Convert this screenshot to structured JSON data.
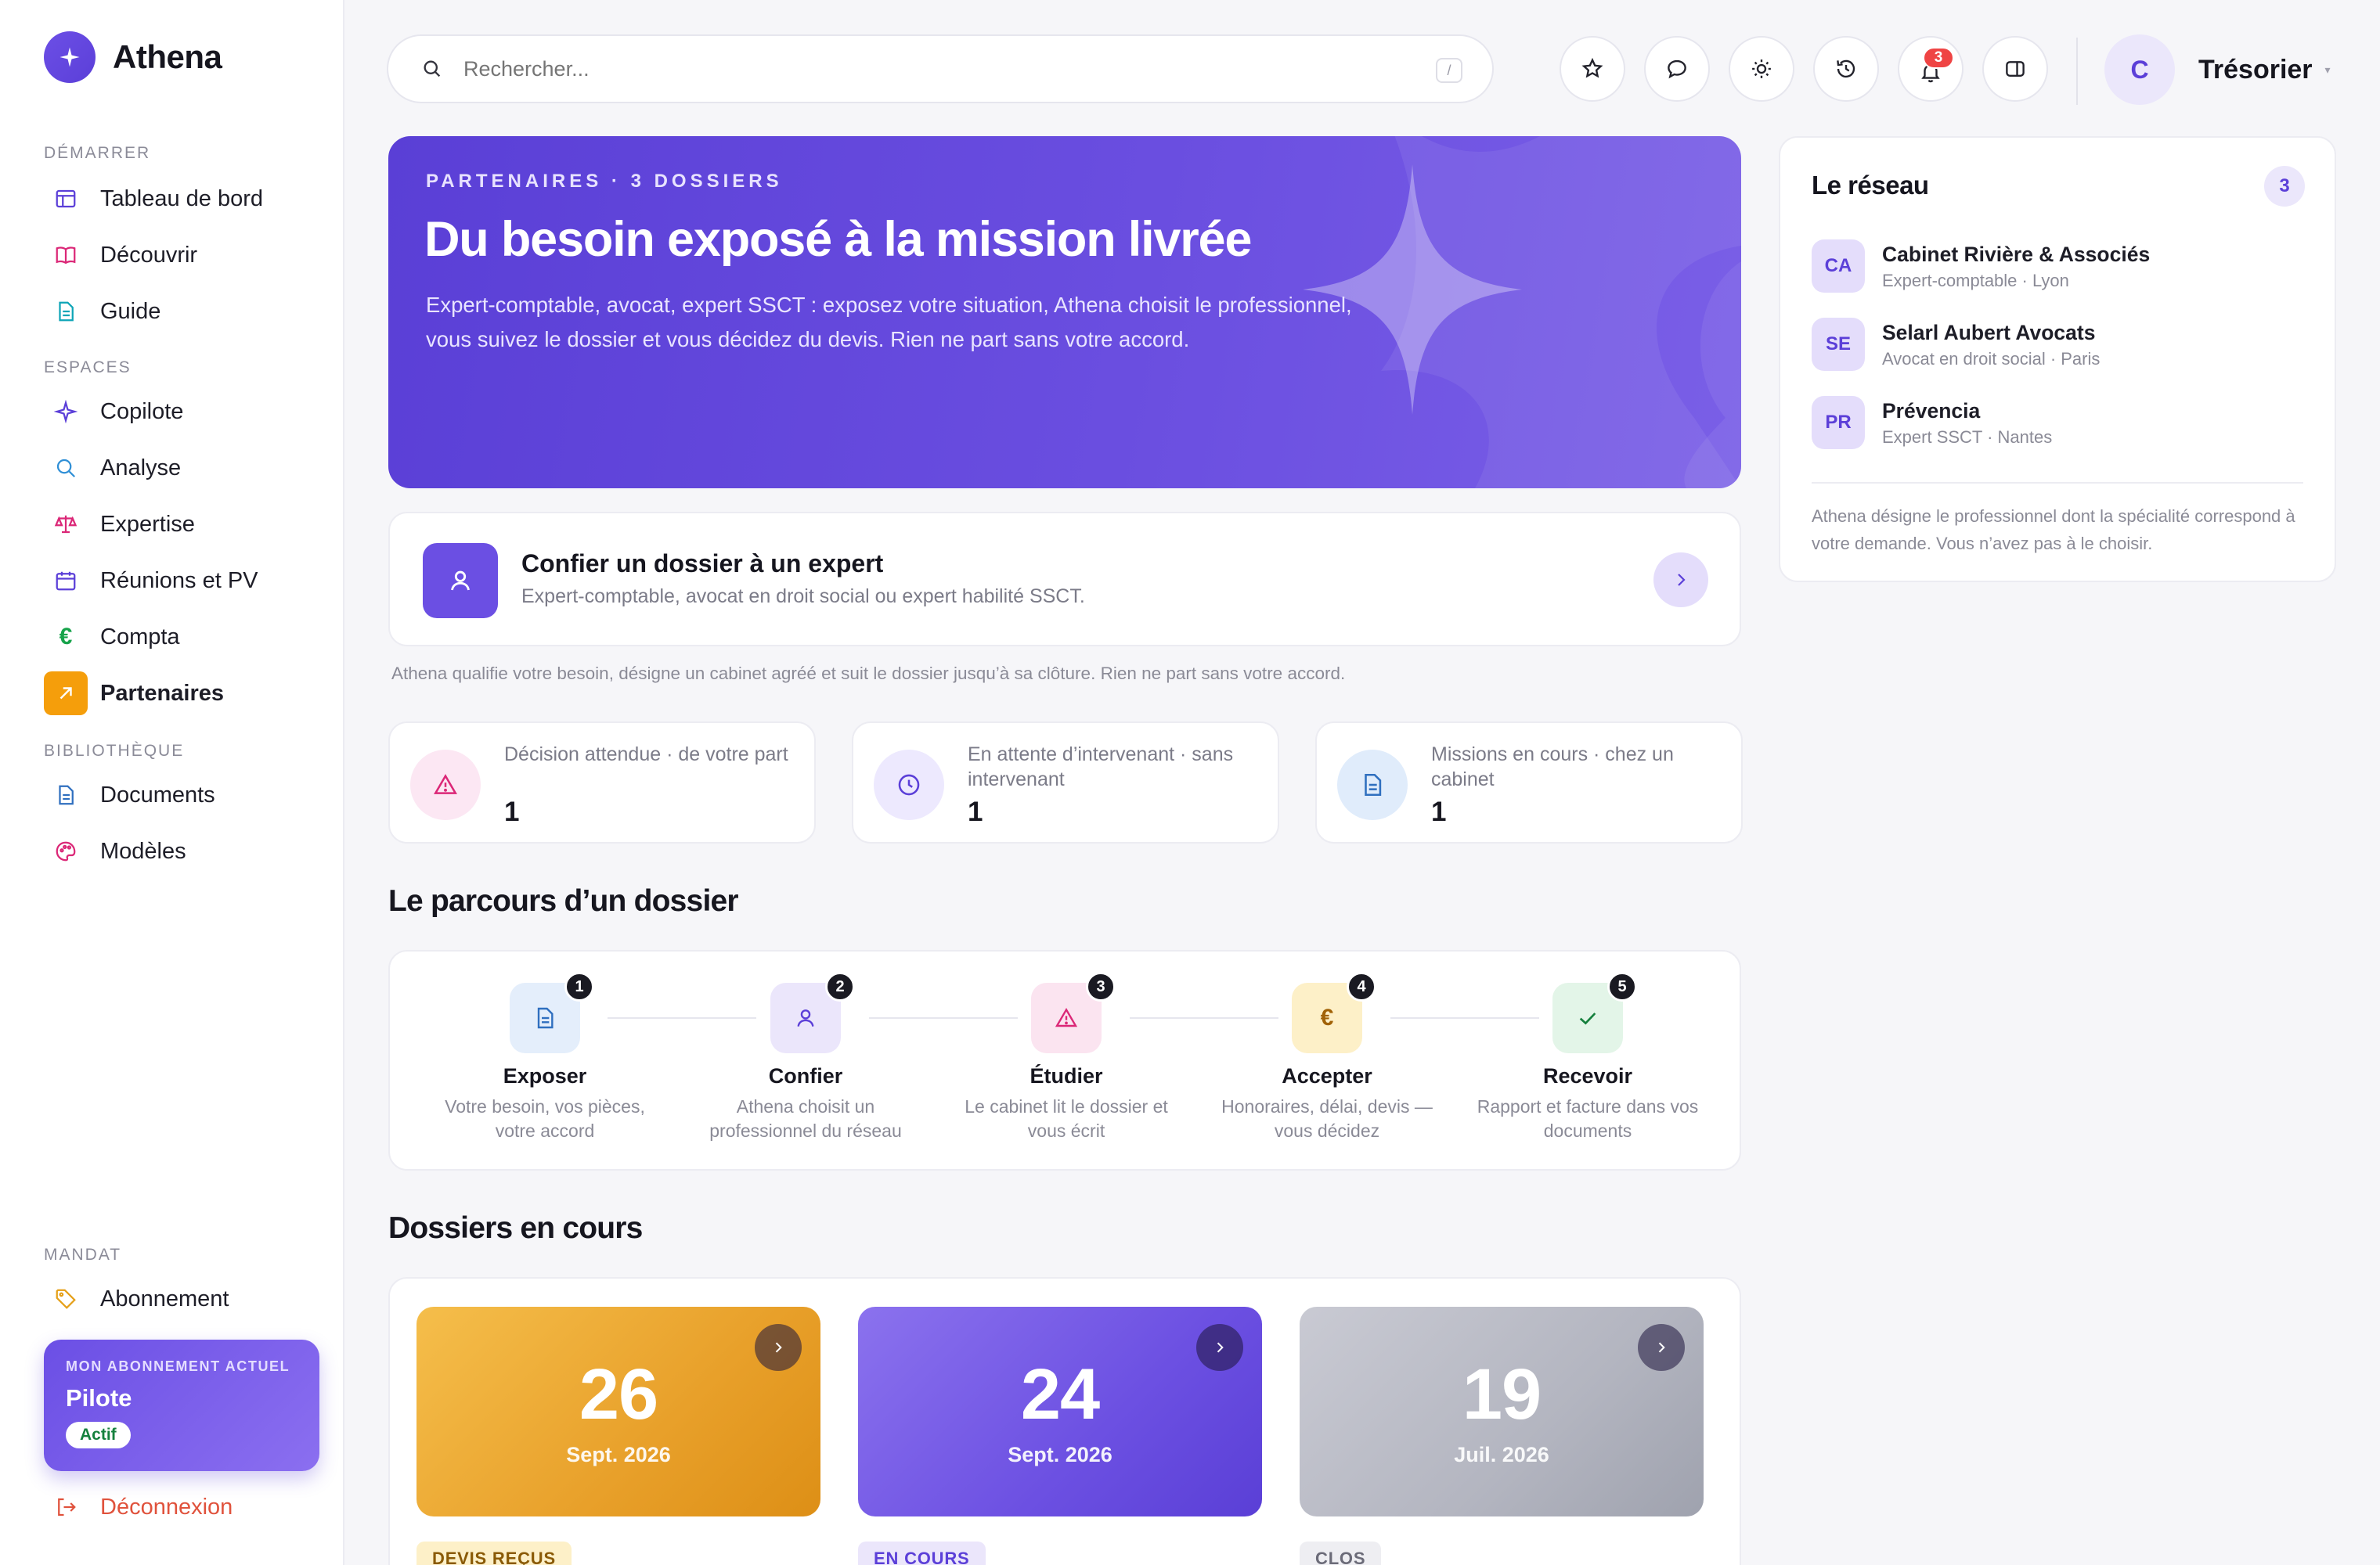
{
  "app": {
    "name": "Athena"
  },
  "sidebar": {
    "sections": {
      "start": "DÉMARRER",
      "spaces": "ESPACES",
      "library": "BIBLIOTHÈQUE",
      "mandate": "MANDAT"
    },
    "items": [
      {
        "label": "Tableau de bord",
        "icon": "layout-icon"
      },
      {
        "label": "Découvrir",
        "icon": "book-icon"
      },
      {
        "label": "Guide",
        "icon": "file-icon"
      },
      {
        "label": "Copilote",
        "icon": "sparkle-icon"
      },
      {
        "label": "Analyse",
        "icon": "search-icon"
      },
      {
        "label": "Expertise",
        "icon": "scale-icon"
      },
      {
        "label": "Réunions et PV",
        "icon": "calendar-icon"
      },
      {
        "label": "Compta",
        "icon": "euro-icon"
      },
      {
        "label": "Partenaires",
        "icon": "arrow-up-right-icon",
        "active": true
      },
      {
        "label": "Documents",
        "icon": "document-icon"
      },
      {
        "label": "Modèles",
        "icon": "palette-icon"
      },
      {
        "label": "Abonnement",
        "icon": "tag-icon"
      },
      {
        "label": "Déconnexion",
        "icon": "logout-icon"
      }
    ],
    "subscription": {
      "kicker": "MON ABONNEMENT ACTUEL",
      "plan": "Pilote",
      "status": "Actif"
    }
  },
  "topbar": {
    "search_placeholder": "Rechercher...",
    "search_shortcut": "/",
    "notifications_count": "3",
    "user": {
      "initial": "C",
      "name": "Trésorier",
      "caret": "▾"
    }
  },
  "hero": {
    "kicker": "PARTENAIRES · 3 DOSSIERS",
    "title": "Du besoin exposé à la mission livrée",
    "text": "Expert-comptable, avocat, expert SSCT : exposez votre situation, Athena choisit le professionnel, vous suivez le dossier et vous décidez du devis. Rien ne part sans votre accord."
  },
  "confier": {
    "title": "Confier un dossier à un expert",
    "subtitle": "Expert-comptable, avocat en droit social ou expert habilité SSCT.",
    "note": "Athena qualifie votre besoin, désigne un cabinet agréé et suit le dossier jusqu’à sa clôture. Rien ne part sans votre accord."
  },
  "stats": [
    {
      "label": "Décision attendue · de votre part",
      "value": "1",
      "icon": "warning-icon",
      "bg": "#fce7f3",
      "color": "#db2777"
    },
    {
      "label": "En attente d’intervenant · sans intervenant",
      "value": "1",
      "icon": "clock-icon",
      "bg": "#ede9fe",
      "color": "#5b3fd8"
    },
    {
      "label": "Missions en cours · chez un cabinet",
      "value": "1",
      "icon": "document-icon",
      "bg": "#e0ecfb",
      "color": "#2f6fbf"
    }
  ],
  "parcours": {
    "title": "Le parcours d’un dossier",
    "steps": [
      {
        "num": "1",
        "title": "Exposer",
        "desc": "Votre besoin, vos pièces, votre accord",
        "icon": "document-icon",
        "bg": "#e4eefb",
        "color": "#2f6fbf"
      },
      {
        "num": "2",
        "title": "Confier",
        "desc": "Athena choisit un professionnel du réseau",
        "icon": "user-icon",
        "bg": "#ebe6fb",
        "color": "#5b3fd8"
      },
      {
        "num": "3",
        "title": "Étudier",
        "desc": "Le cabinet lit le dossier et vous écrit",
        "icon": "warning-icon",
        "bg": "#fbe4f0",
        "color": "#db2777"
      },
      {
        "num": "4",
        "title": "Accepter",
        "desc": "Honoraires, délai, devis — vous décidez",
        "icon": "euro-icon",
        "bg": "#fdf0c8",
        "color": "#a16207"
      },
      {
        "num": "5",
        "title": "Recevoir",
        "desc": "Rapport et facture dans vos documents",
        "icon": "check-icon",
        "bg": "#e3f5e8",
        "color": "#15803d"
      }
    ]
  },
  "dossiers": {
    "title": "Dossiers en cours",
    "items": [
      {
        "day": "26",
        "month": "Sept. 2026",
        "status": "DEVIS REÇUS",
        "gradient": "linear-gradient(135deg,#f5be4b 0%,#e8a02a 60%,#dd8f16 100%)",
        "tag_bg": "#fdf0c8",
        "tag_color": "#8a5a06"
      },
      {
        "day": "24",
        "month": "Sept. 2026",
        "status": "EN COURS",
        "gradient": "linear-gradient(135deg,#8b72ee 0%,#6c50e2 60%,#5a3fd6 100%)",
        "tag_bg": "#ebe6fb",
        "tag_color": "#5b3fd8"
      },
      {
        "day": "19",
        "month": "Juil. 2026",
        "status": "CLOS",
        "gradient": "linear-gradient(135deg,#c9cad3 0%,#b3b5c0 60%,#9fa2ae 100%)",
        "tag_bg": "#eeeef2",
        "tag_color": "#6b6b78"
      }
    ]
  },
  "reseau": {
    "title": "Le réseau",
    "count": "3",
    "members": [
      {
        "initials": "CA",
        "name": "Cabinet Rivière & Associés",
        "sub": "Expert-comptable · Lyon"
      },
      {
        "initials": "SE",
        "name": "Selarl Aubert Avocats",
        "sub": "Avocat en droit social · Paris"
      },
      {
        "initials": "PR",
        "name": "Prévencia",
        "sub": "Expert SSCT · Nantes"
      }
    ],
    "note": "Athena désigne le professionnel dont la spécialité correspond à votre demande. Vous n’avez pas à le choisir."
  }
}
